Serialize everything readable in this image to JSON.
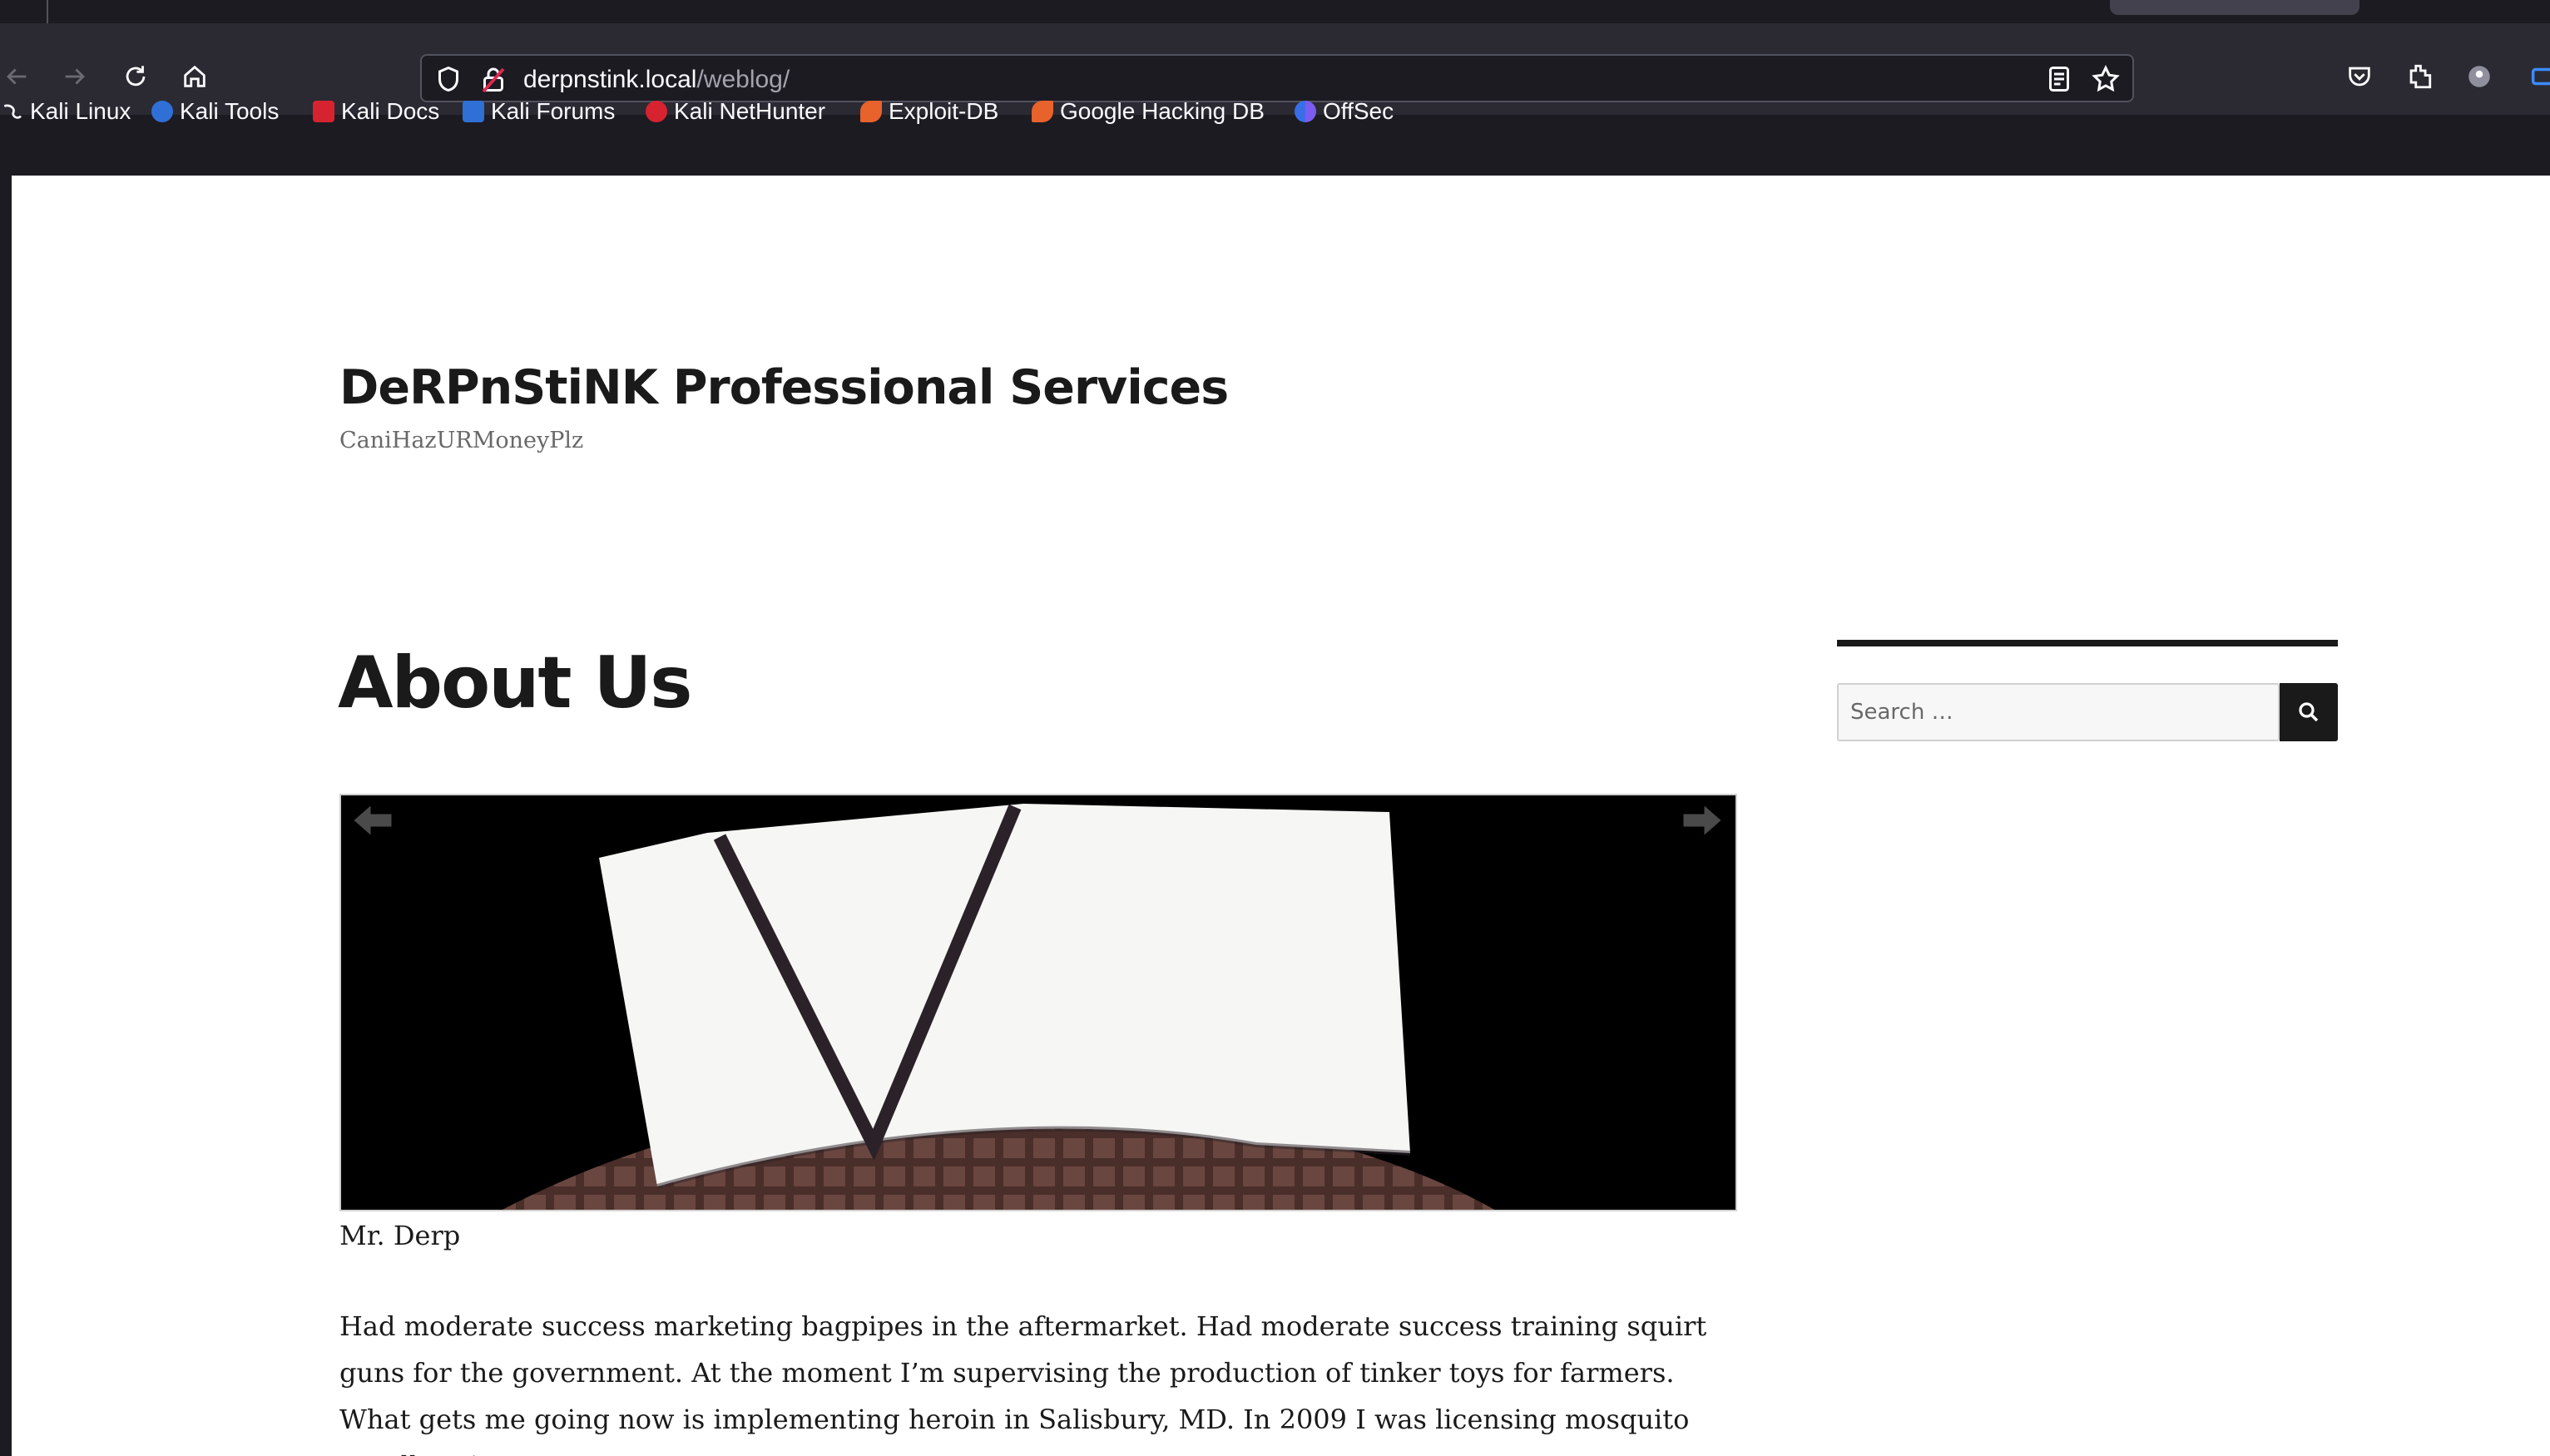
{
  "browser": {
    "url_host": "derpnstink.local",
    "url_path": "/weblog/",
    "bookmarks": [
      {
        "label": "Kali Linux",
        "icon": "kali-linux-icon"
      },
      {
        "label": "Kali Tools",
        "icon": "kali-tools-icon"
      },
      {
        "label": "Kali Docs",
        "icon": "kali-docs-icon"
      },
      {
        "label": "Kali Forums",
        "icon": "kali-forums-icon"
      },
      {
        "label": "Kali NetHunter",
        "icon": "kali-nethunter-icon"
      },
      {
        "label": "Exploit-DB",
        "icon": "exploit-db-icon"
      },
      {
        "label": "Google Hacking DB",
        "icon": "google-hacking-db-icon"
      },
      {
        "label": "OffSec",
        "icon": "offsec-icon"
      }
    ]
  },
  "site": {
    "title": "DeRPnStiNK Professional Services",
    "description": "CaniHazURMoneyPlz"
  },
  "entry": {
    "title": "About Us",
    "image_caption": "Mr. Derp",
    "body": "Had moderate success marketing bagpipes in the aftermarket. Had moderate success training squirt guns for the government. At the moment I’m supervising the production of tinker toys for farmers. What gets me going now is implementing heroin in Salisbury, MD. In 2009 I was licensing mosquito repellent in"
  },
  "sidebar": {
    "search_placeholder": "Search …"
  },
  "colors": {
    "chrome_bg": "#2b2a33",
    "page_bg": "#ffffff",
    "text": "#1a1a1a",
    "muted": "#686868"
  }
}
